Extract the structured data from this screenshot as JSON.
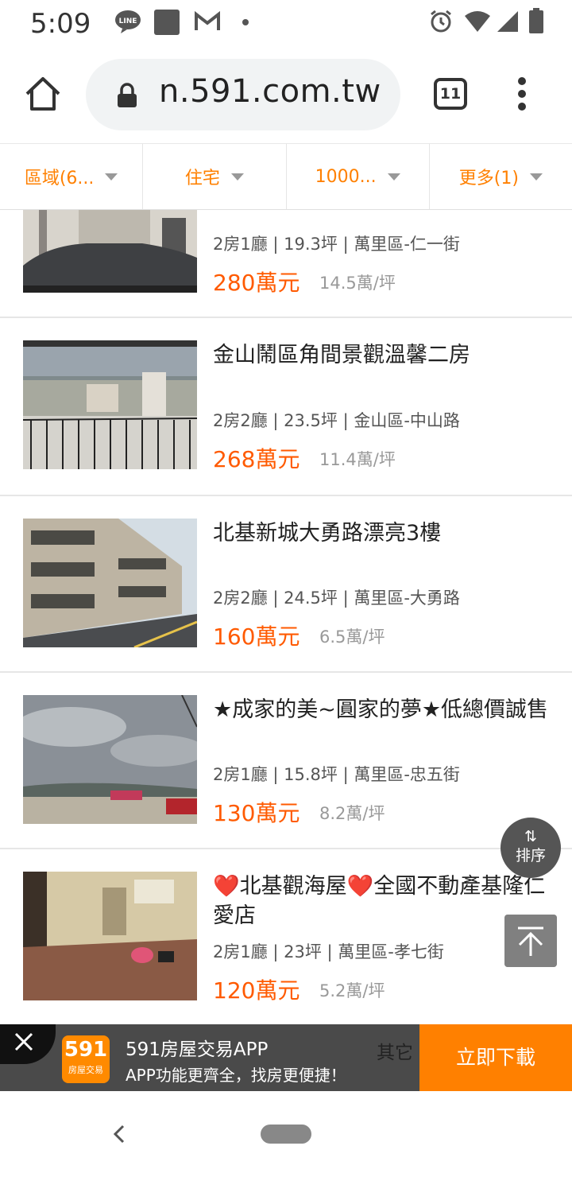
{
  "status_bar": {
    "time": "5:09"
  },
  "browser": {
    "url": "n.591.com.tw",
    "tab_count": "11"
  },
  "filters": [
    {
      "label": "區域(6..."
    },
    {
      "label": "住宅"
    },
    {
      "label": "1000..."
    },
    {
      "label": "更多(1)"
    }
  ],
  "listings": [
    {
      "title": "",
      "meta": "2房1廳 | 19.3坪 | 萬里區-仁一街",
      "price": "280萬元",
      "unit_price": "14.5萬/坪"
    },
    {
      "title": "金山鬧區角間景觀溫馨二房",
      "meta": "2房2廳 | 23.5坪 | 金山區-中山路",
      "price": "268萬元",
      "unit_price": "11.4萬/坪"
    },
    {
      "title": "北基新城大勇路漂亮3樓",
      "meta": "2房2廳 | 24.5坪 | 萬里區-大勇路",
      "price": "160萬元",
      "unit_price": "6.5萬/坪"
    },
    {
      "title": "★成家的美~圓家的夢★低總價誠售",
      "meta": "2房1廳 | 15.8坪 | 萬里區-忠五街",
      "price": "130萬元",
      "unit_price": "8.2萬/坪"
    },
    {
      "title": "❤️北基觀海屋❤️全國不動產基隆仁愛店",
      "meta": "2房1廳 | 23坪 | 萬里區-孝七街",
      "price": "120萬元",
      "unit_price": "5.2萬/坪"
    }
  ],
  "sort_button": {
    "label": "排序"
  },
  "app_banner": {
    "logo_number": "591",
    "logo_text": "房屋交易",
    "title": "591房屋交易APP",
    "subtitle": "APP功能更齊全，找房更便捷！",
    "ghost_text": "其它",
    "download_label": "立即下載"
  },
  "colors": {
    "accent": "#ff8000",
    "price": "#ff5a00"
  }
}
